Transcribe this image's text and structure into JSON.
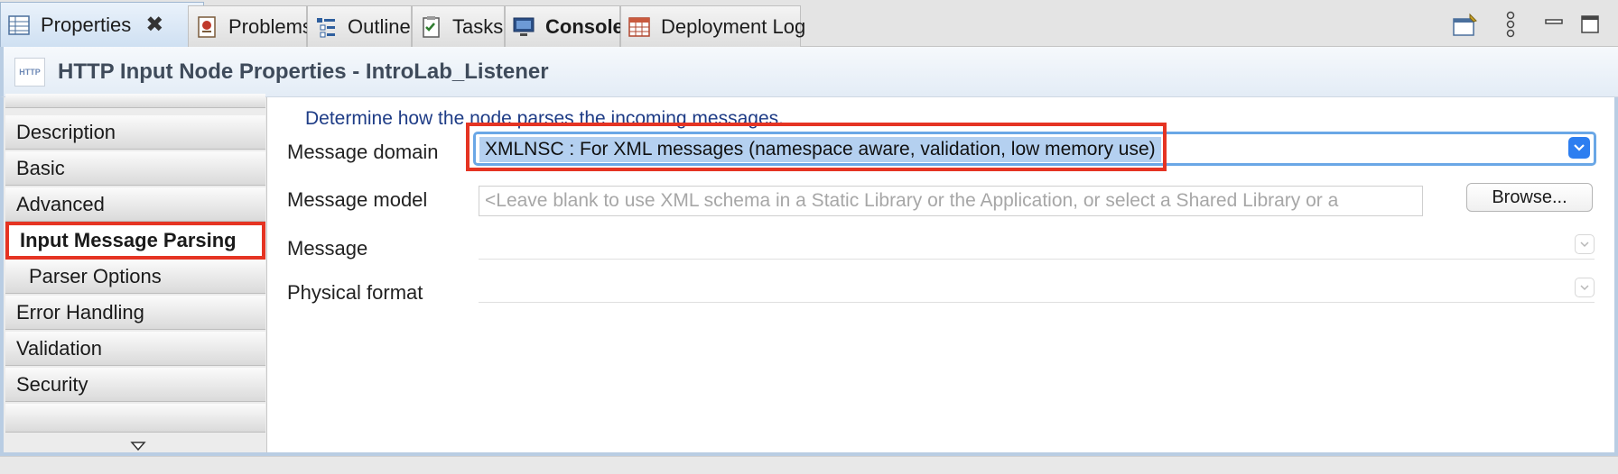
{
  "tabs": [
    {
      "label": "Properties",
      "icon": "properties-icon",
      "active": true,
      "closable": true
    },
    {
      "label": "Problems",
      "icon": "problems-icon"
    },
    {
      "label": "Outline",
      "icon": "outline-icon"
    },
    {
      "label": "Tasks",
      "icon": "tasks-icon"
    },
    {
      "label": "Console",
      "icon": "console-icon",
      "bold": true
    },
    {
      "label": "Deployment Log",
      "icon": "deployment-log-icon"
    }
  ],
  "tab_close_glyph": "✖",
  "toolbar_right": {
    "pin_icon": "pin-editor-icon",
    "menu_icon": "view-menu-icon",
    "minimize_icon": "minimize-icon",
    "maximize_icon": "maximize-icon"
  },
  "header": {
    "icon_text": "HTTP",
    "title": "HTTP Input Node Properties - IntroLab_Listener"
  },
  "sidebar": {
    "items": [
      {
        "label": "Description"
      },
      {
        "label": "Basic"
      },
      {
        "label": "Advanced"
      },
      {
        "label": "Input Message Parsing",
        "selected": true
      },
      {
        "label": "Parser Options",
        "sub": true
      },
      {
        "label": "Error Handling"
      },
      {
        "label": "Validation"
      },
      {
        "label": "Security"
      }
    ],
    "scroll_down_icon": "scroll-down-icon"
  },
  "main": {
    "description": "Determine how the node parses the incoming messages.",
    "message_domain": {
      "label": "Message domain",
      "value": "XMLNSC : For XML messages (namespace aware, validation, low memory use)"
    },
    "message_model": {
      "label": "Message model",
      "placeholder": "<Leave blank to use XML schema in a Static Library or the Application, or select a Shared Library or a",
      "browse_label": "Browse..."
    },
    "message": {
      "label": "Message",
      "value": ""
    },
    "physical_format": {
      "label": "Physical format",
      "value": ""
    }
  },
  "colors": {
    "highlight_red": "#e53423",
    "selection_blue": "#b4d0f0",
    "focus_blue": "#6aa7e6",
    "description_text": "#1e3c86"
  }
}
